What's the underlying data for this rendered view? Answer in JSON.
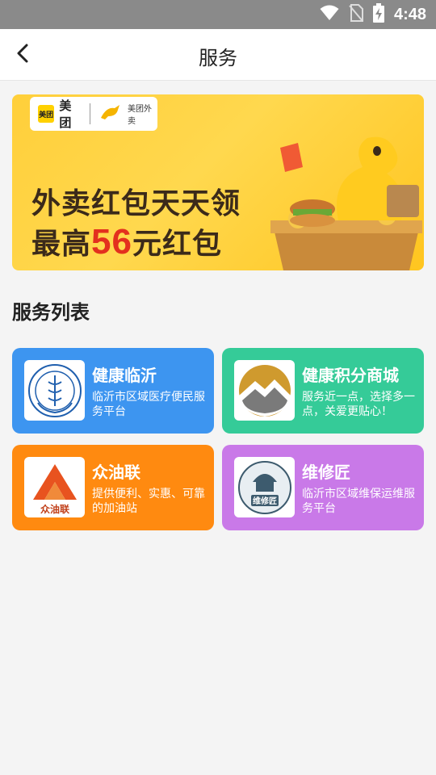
{
  "status_bar": {
    "time": "4:48",
    "icons": [
      "wifi-icon",
      "no-sim-icon",
      "battery-charging-icon"
    ]
  },
  "app_bar": {
    "title": "服务",
    "back_icon": "chevron-left-icon"
  },
  "banner": {
    "brand_left": "美团",
    "brand_logo_text": "美团",
    "brand_right": "美团外卖",
    "line1": "外卖红包天天领",
    "line2_prefix": "最高",
    "line2_number": "56",
    "line2_suffix": "元红包"
  },
  "section": {
    "title": "服务列表"
  },
  "services": [
    {
      "name": "健康临沂",
      "description": "临沂市区域医疗便民服务平台",
      "color": "#3d95f0"
    },
    {
      "name": "健康积分商城",
      "description": "服务近一点，选择多一点，关爱更贴心！",
      "color": "#35cb98"
    },
    {
      "name": "众油联",
      "description": "提供便利、实惠、可靠的加油站",
      "logo_text": "众油联",
      "color": "#ff8a10"
    },
    {
      "name": "维修匠",
      "description": "临沂市区域维保运维服务平台",
      "logo_text": "维修匠",
      "color": "#c979e8"
    }
  ]
}
